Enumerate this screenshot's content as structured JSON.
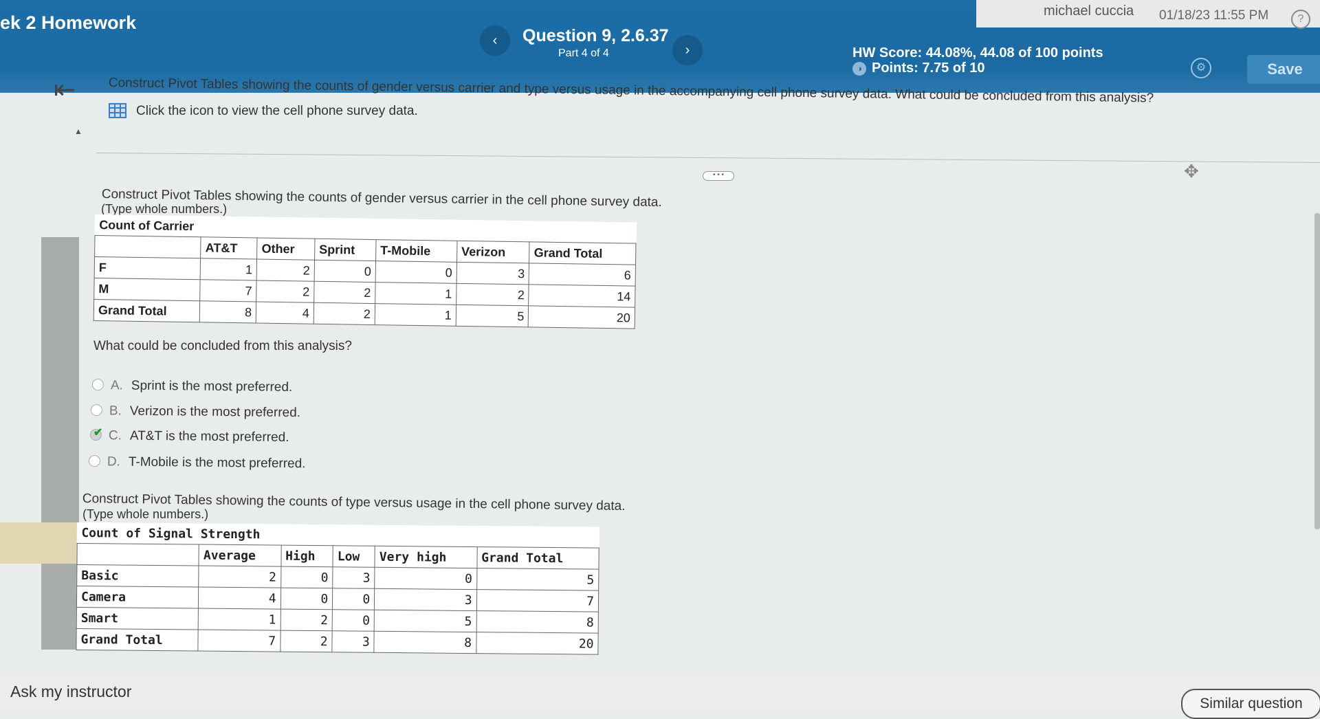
{
  "header": {
    "course_title": "ek 2 Homework",
    "question_title": "Question 9, 2.6.37",
    "part": "Part 4 of 4",
    "hw_score": "HW Score: 44.08%, 44.08 of 100 points",
    "points": "Points: 7.75 of 10",
    "user_name": "michael cuccia",
    "timestamp": "01/18/23 11:55 PM",
    "save_label": "Save",
    "prev_label": "‹",
    "next_label": "›",
    "help_label": "?"
  },
  "prompt": "Construct Pivot Tables showing the counts of gender versus carrier and type versus usage in the accompanying cell phone survey data. What could be concluded from this analysis?",
  "data_link": "Click the icon to view the cell phone survey data.",
  "section1": {
    "instruction": "Construct Pivot Tables showing the counts of gender versus carrier in the cell phone survey data.",
    "hint": "(Type whole numbers.)",
    "table": {
      "title": "Count of Carrier",
      "columns": [
        "AT&T",
        "Other",
        "Sprint",
        "T-Mobile",
        "Verizon",
        "Grand Total"
      ],
      "rows": [
        {
          "label": "F",
          "values": [
            "1",
            "2",
            "0",
            "0",
            "3",
            "6"
          ]
        },
        {
          "label": "M",
          "values": [
            "7",
            "2",
            "2",
            "1",
            "2",
            "14"
          ]
        },
        {
          "label": "Grand Total",
          "values": [
            "8",
            "4",
            "2",
            "1",
            "5",
            "20"
          ]
        }
      ]
    }
  },
  "question2": "What could be concluded from this analysis?",
  "options": [
    {
      "letter": "A.",
      "text": "Sprint is the most preferred.",
      "selected": false
    },
    {
      "letter": "B.",
      "text": "Verizon is the most preferred.",
      "selected": false
    },
    {
      "letter": "C.",
      "text": "AT&T is the most preferred.",
      "selected": true
    },
    {
      "letter": "D.",
      "text": "T-Mobile is the most preferred.",
      "selected": false
    }
  ],
  "section2": {
    "instruction": "Construct Pivot Tables showing the counts of type versus usage in the cell phone survey data.",
    "hint": "(Type whole numbers.)",
    "table": {
      "title": "Count of Signal Strength",
      "columns": [
        "Average",
        "High",
        "Low",
        "Very high",
        "Grand Total"
      ],
      "rows": [
        {
          "label": "Basic",
          "values": [
            "2",
            "0",
            "3",
            "0",
            "5"
          ]
        },
        {
          "label": "Camera",
          "values": [
            "4",
            "0",
            "0",
            "3",
            "7"
          ]
        },
        {
          "label": "Smart",
          "values": [
            "1",
            "2",
            "0",
            "5",
            "8"
          ]
        },
        {
          "label": "Grand Total",
          "values": [
            "7",
            "2",
            "3",
            "8",
            "20"
          ]
        }
      ]
    }
  },
  "footer": {
    "ask_label": "Ask my instructor",
    "similar_label": "Similar question"
  },
  "icons": [
    "collapse-left-icon",
    "grid-table-icon",
    "gear-icon",
    "help-icon",
    "points-badge-icon",
    "move-icon",
    "check-icon"
  ],
  "colors": {
    "header_blue": "#1b6aa3",
    "save_button": "#3a88bd",
    "check_green": "#1a9a2a"
  }
}
